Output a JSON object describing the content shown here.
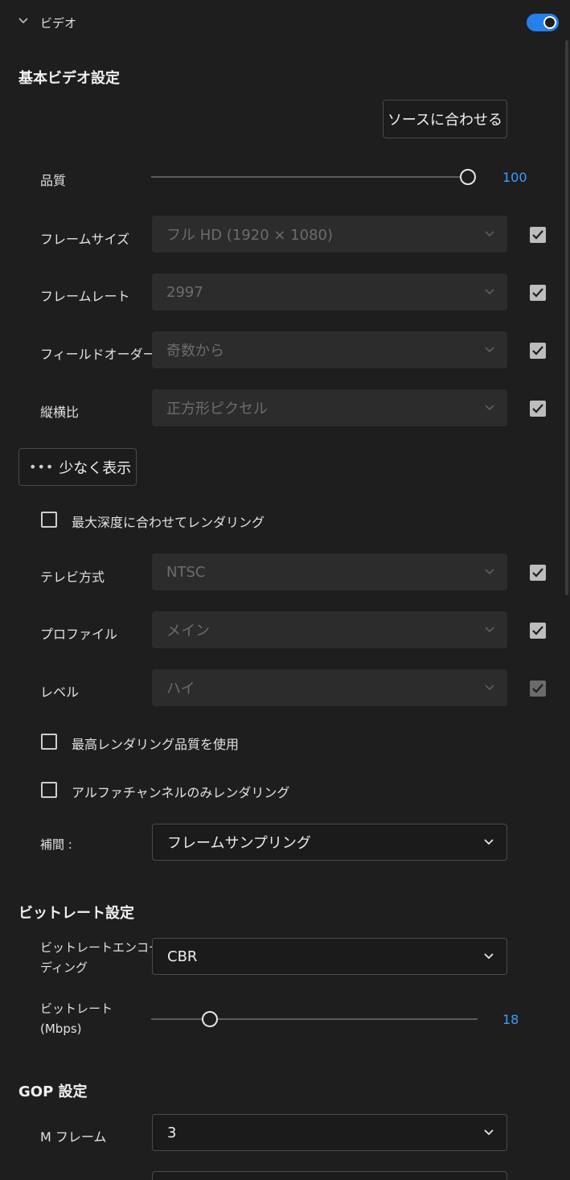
{
  "header": {
    "title": "ビデオ",
    "toggle_on": true
  },
  "basic": {
    "title": "基本ビデオ設定",
    "match_source": "ソースに合わせる",
    "quality": {
      "label": "品質",
      "value": "100",
      "level": 1.0
    },
    "rows": [
      {
        "label": "フレームサイズ",
        "value": "フル HD (1920 × 1080)",
        "checked": true
      },
      {
        "label": "フレームレート",
        "value": "2997",
        "checked": true
      },
      {
        "label": "フィールドオーダー",
        "value": "奇数から",
        "checked": true
      },
      {
        "label": "縦横比",
        "value": "正方形ピクセル",
        "checked": true
      }
    ],
    "show_less": "少なく表示",
    "max_depth": {
      "label": "最大深度に合わせてレンダリング",
      "checked": false
    },
    "rows2": [
      {
        "label": "テレビ方式",
        "value": "NTSC",
        "checked": true
      },
      {
        "label": "プロファイル",
        "value": "メイン",
        "checked": true
      },
      {
        "label": "レベル",
        "value": "ハイ",
        "checked": true
      }
    ],
    "max_quality": {
      "label": "最高レンダリング品質を使用",
      "checked": false
    },
    "alpha_only": {
      "label": "アルファチャンネルのみレンダリング",
      "checked": false
    },
    "interp": {
      "label": "補間 :",
      "value": "フレームサンプリング"
    }
  },
  "bitrate": {
    "title": "ビットレート設定",
    "encoding": {
      "label_line1": "ビットレートエンコー",
      "label_line2": "ディング",
      "value": "CBR"
    },
    "rate": {
      "label_line1": "ビットレート",
      "label_line2": "(Mbps)",
      "value": "18",
      "level": 0.18
    }
  },
  "gop": {
    "title": "GOP 設定",
    "m_frame": {
      "label": "M フレーム",
      "value": "3"
    }
  },
  "icons": [
    "chevron-down-icon",
    "checkbox-icon",
    "ellipsis-icon",
    "toggle-switch"
  ],
  "colors": {
    "accent": "#2680eb",
    "value_blue": "#3d9bff",
    "background": "#1e1e1e"
  }
}
